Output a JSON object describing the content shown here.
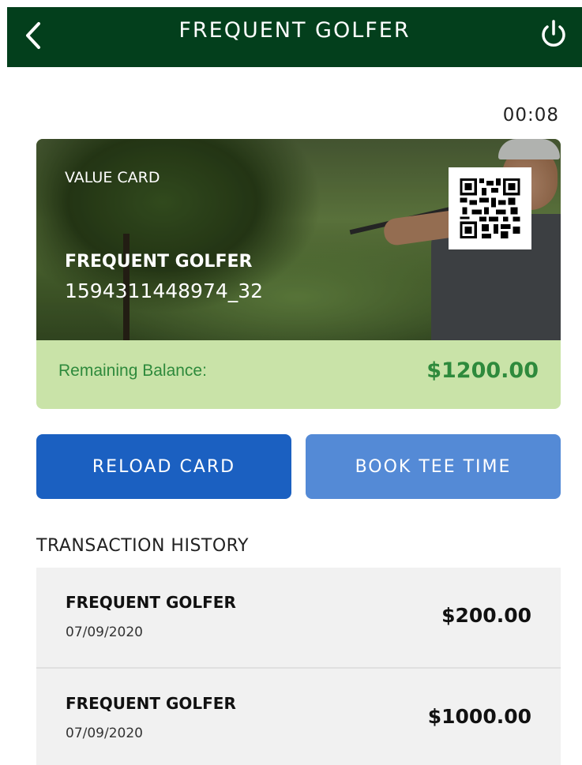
{
  "header": {
    "title": "FREQUENT GOLFER",
    "back_icon": "chevron-left-icon",
    "power_icon": "power-icon",
    "background_color": "#033f1c"
  },
  "timer": "00:08",
  "card": {
    "type_label": "VALUE CARD",
    "name": "FREQUENT GOLFER",
    "number": "1594311448974_32",
    "balance_label": "Remaining Balance:",
    "balance_value": "$1200.00",
    "balance_bg_color": "#c9e3a8",
    "balance_text_color": "#2e8a3c"
  },
  "buttons": {
    "reload_label": "RELOAD CARD",
    "book_label": "BOOK TEE TIME",
    "reload_color": "#1b60c1",
    "book_color": "#548ad6"
  },
  "transactions": {
    "title": "TRANSACTION HISTORY",
    "items": [
      {
        "name": "FREQUENT GOLFER",
        "date": "07/09/2020",
        "amount": "$200.00"
      },
      {
        "name": "FREQUENT GOLFER",
        "date": "07/09/2020",
        "amount": "$1000.00"
      }
    ]
  }
}
